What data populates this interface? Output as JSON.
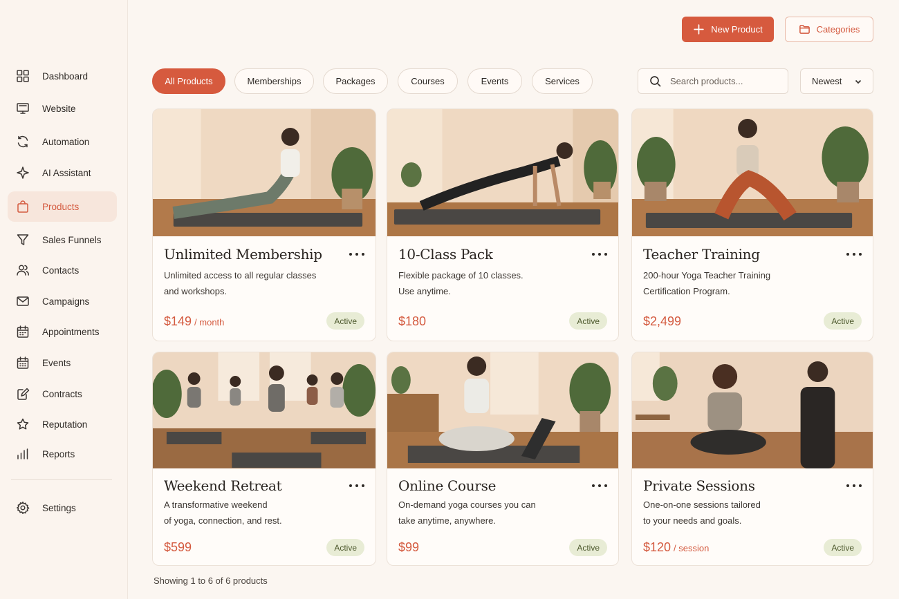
{
  "sidebar": {
    "items": [
      {
        "label": "Dashboard",
        "icon": "grid-icon"
      },
      {
        "label": "Website",
        "icon": "monitor-icon"
      },
      {
        "label": "Automation",
        "icon": "refresh-icon"
      },
      {
        "label": "AI Assistant",
        "icon": "sparkle-icon"
      },
      {
        "label": "Products",
        "icon": "shopping-bag-icon",
        "active": true
      },
      {
        "label": "Sales Funnels",
        "icon": "funnel-icon"
      },
      {
        "label": "Contacts",
        "icon": "users-icon"
      },
      {
        "label": "Campaigns",
        "icon": "mail-icon"
      },
      {
        "label": "Appointments",
        "icon": "calendar-icon"
      },
      {
        "label": "Events",
        "icon": "calendar-grid-icon"
      },
      {
        "label": "Contracts",
        "icon": "edit-document-icon"
      },
      {
        "label": "Reputation",
        "icon": "star-icon"
      },
      {
        "label": "Reports",
        "icon": "bar-chart-icon"
      }
    ],
    "settings": {
      "label": "Settings",
      "icon": "gear-icon"
    }
  },
  "header": {
    "new_product_label": "New Product",
    "categories_label": "Categories"
  },
  "filters": {
    "chips": [
      "All Products",
      "Memberships",
      "Packages",
      "Courses",
      "Events",
      "Services"
    ],
    "active": "All Products",
    "search_placeholder": "Search products...",
    "sort_value": "Newest"
  },
  "products": [
    {
      "title": "Unlimited Membership",
      "desc1": "Unlimited access to all regular classes",
      "desc2": "and workshops.",
      "price": "$149",
      "unit": "/ month",
      "status": "Active"
    },
    {
      "title": "10-Class Pack",
      "desc1": "Flexible package of 10 classes.",
      "desc2": "Use anytime.",
      "price": "$180",
      "unit": "",
      "status": "Active"
    },
    {
      "title": "Teacher Training",
      "desc1": "200-hour Yoga Teacher Training",
      "desc2": "Certification Program.",
      "price": "$2,499",
      "unit": "",
      "status": "Active"
    },
    {
      "title": "Weekend Retreat",
      "desc1": "A transformative weekend",
      "desc2": "of yoga, connection, and rest.",
      "price": "$599",
      "unit": "",
      "status": "Active"
    },
    {
      "title": "Online Course",
      "desc1": "On-demand yoga courses you can",
      "desc2": "take anytime, anywhere.",
      "price": "$99",
      "unit": "",
      "status": "Active"
    },
    {
      "title": "Private Sessions",
      "desc1": "One-on-one sessions tailored",
      "desc2": "to your needs and goals.",
      "price": "$120",
      "unit": "/ session",
      "status": "Active"
    }
  ],
  "footer": {
    "showing": "Showing 1 to 6 of 6 products"
  },
  "colors": {
    "accent": "#d65a3e",
    "badge_bg": "#e8ecd5",
    "badge_text": "#4e5a2e",
    "background": "#fbf6f1"
  }
}
